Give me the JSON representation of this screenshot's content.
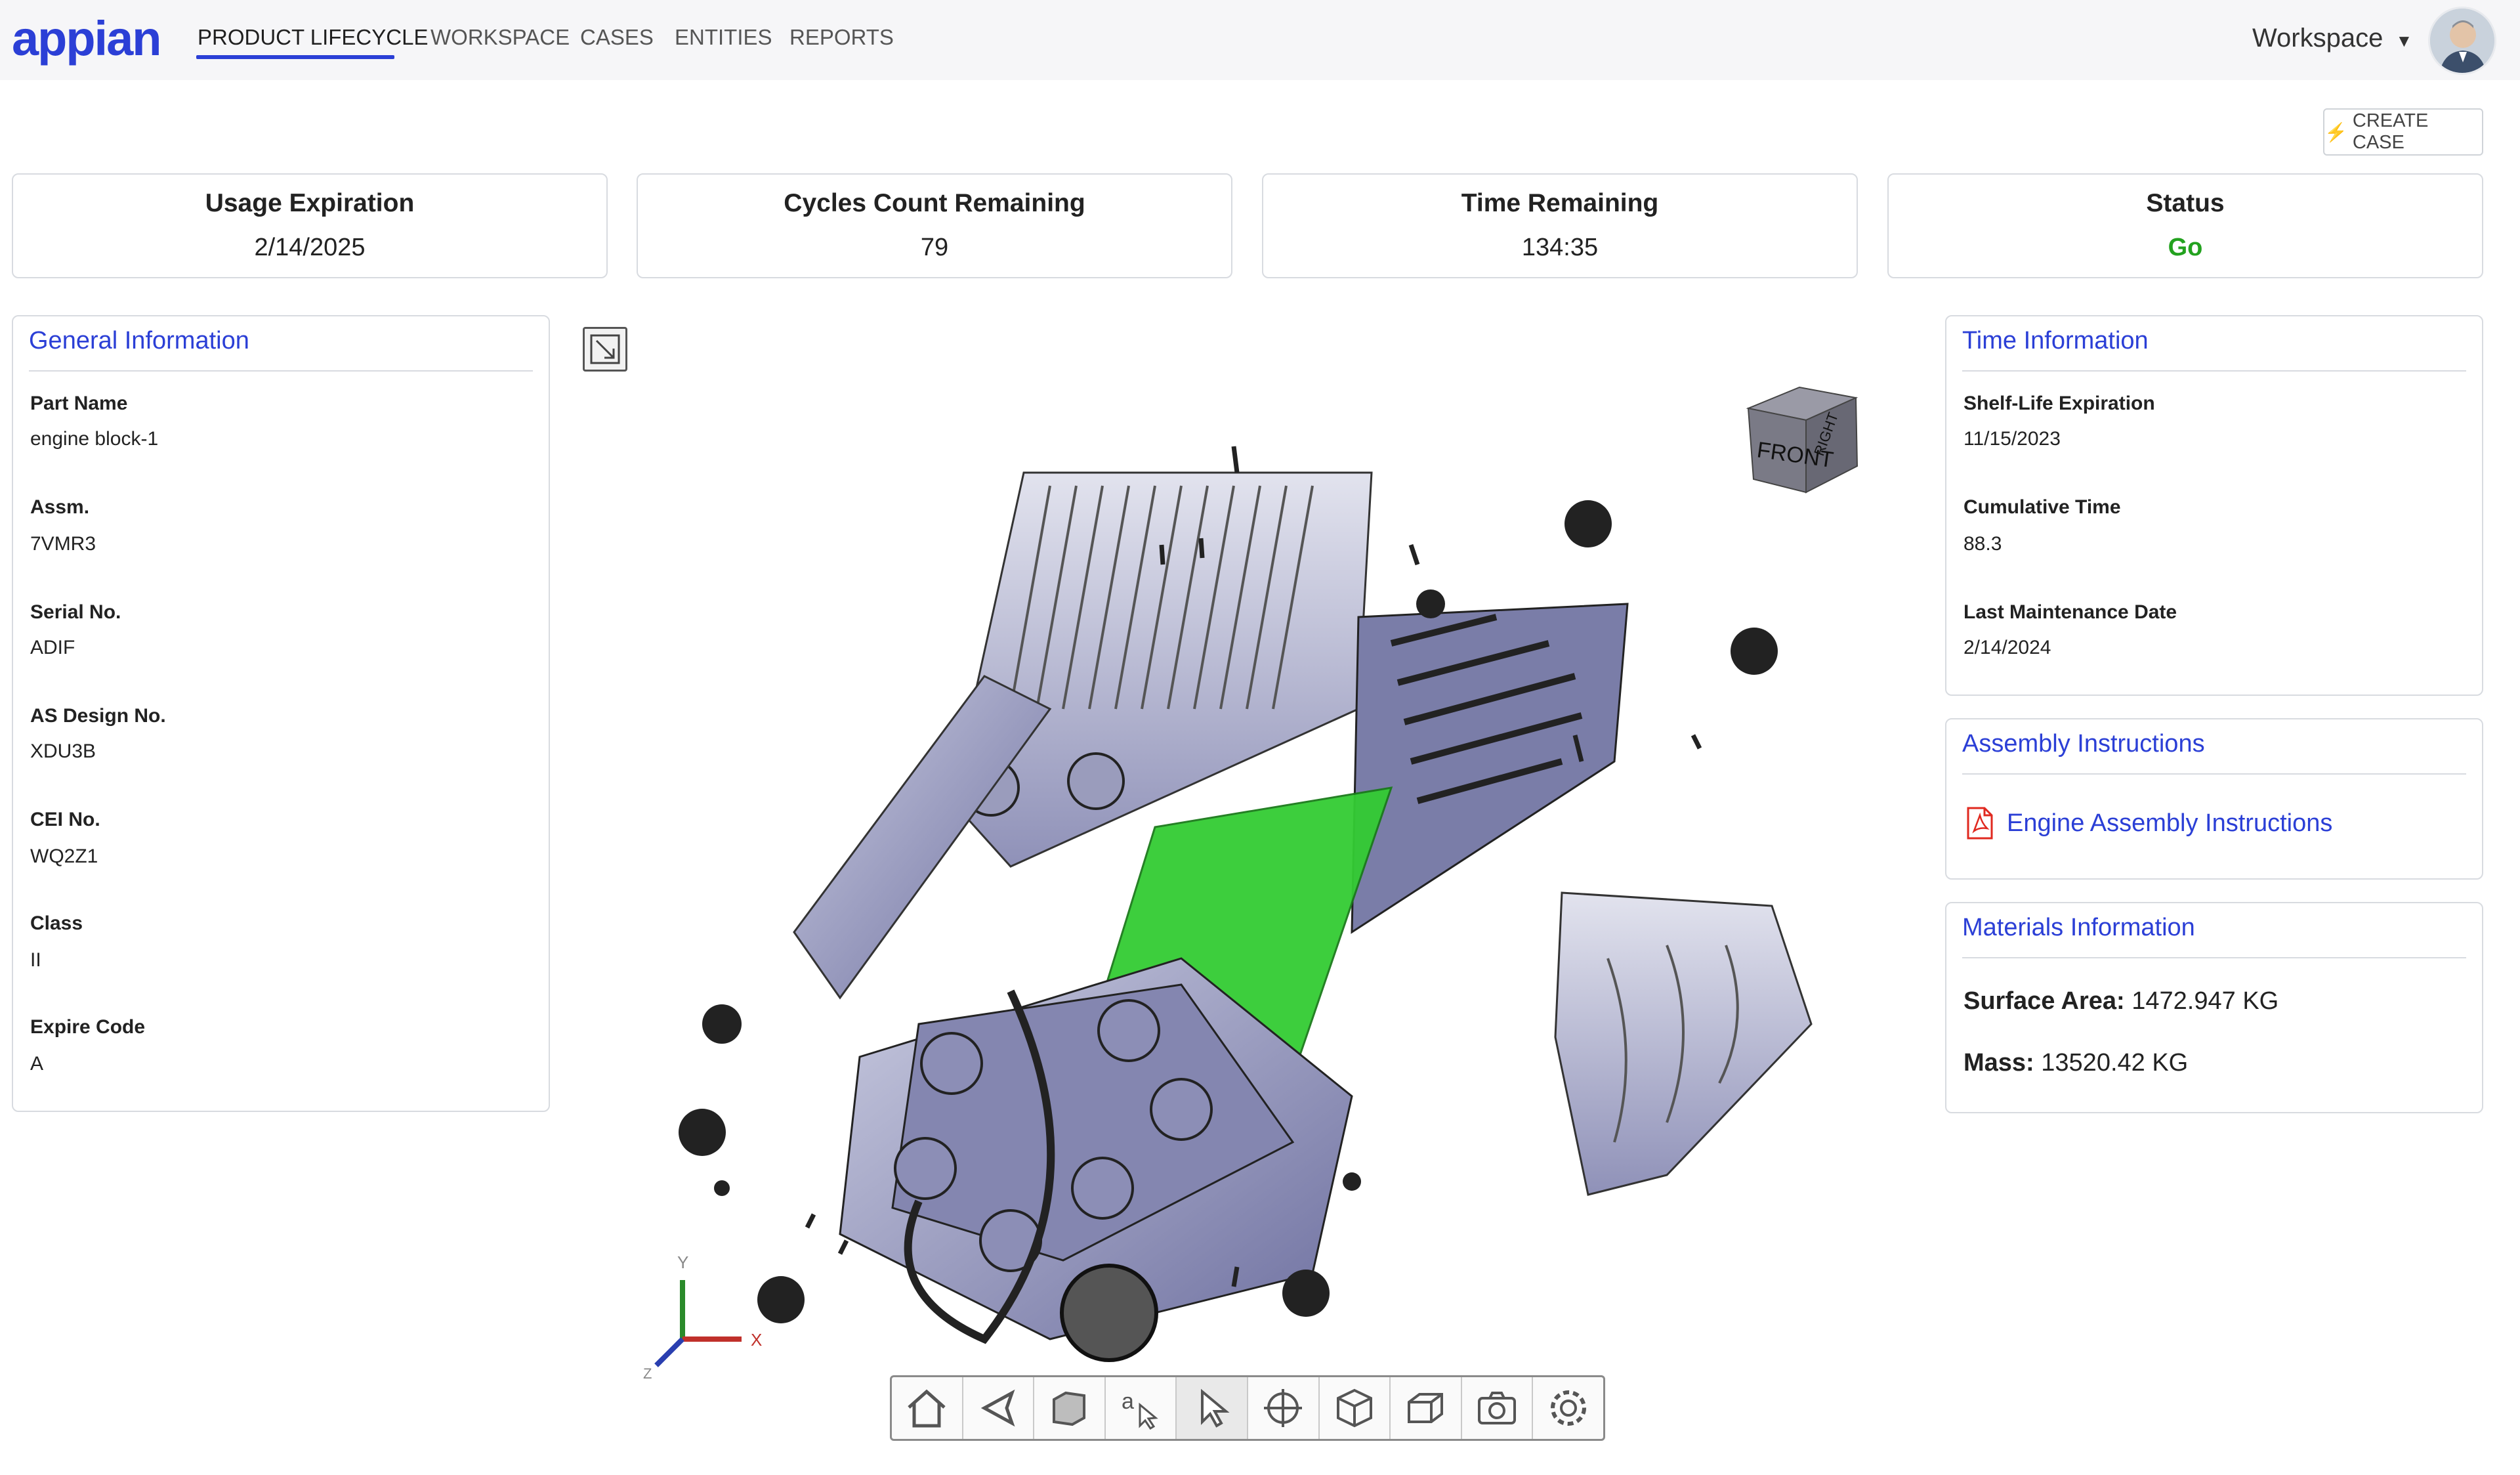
{
  "brand": {
    "logo": "appian",
    "accent": "#2b3fd6",
    "go_color": "#23a21f"
  },
  "nav": {
    "tabs": [
      {
        "label": "PRODUCT LIFECYCLE",
        "active": true
      },
      {
        "label": "WORKSPACE"
      },
      {
        "label": "CASES"
      },
      {
        "label": "ENTITIES"
      },
      {
        "label": "REPORTS"
      }
    ],
    "workspace_menu": "Workspace"
  },
  "actions": {
    "create_case": "CREATE CASE"
  },
  "kpis": [
    {
      "title": "Usage Expiration",
      "value": "2/14/2025"
    },
    {
      "title": "Cycles Count Remaining",
      "value": "79"
    },
    {
      "title": "Time Remaining",
      "value": "134:35"
    },
    {
      "title": "Status",
      "value": "Go"
    }
  ],
  "general": {
    "title": "General Information",
    "fields": [
      {
        "label": "Part Name",
        "value": "engine block-1"
      },
      {
        "label": "Assm.",
        "value": "7VMR3"
      },
      {
        "label": "Serial No.",
        "value": "ADIF"
      },
      {
        "label": "AS Design No.",
        "value": "XDU3B"
      },
      {
        "label": "CEI No.",
        "value": "WQ2Z1"
      },
      {
        "label": "Class",
        "value": "II"
      },
      {
        "label": "Expire Code",
        "value": "A"
      }
    ]
  },
  "time_info": {
    "title": "Time Information",
    "fields": [
      {
        "label": "Shelf-Life Expiration",
        "value": "11/15/2023"
      },
      {
        "label": "Cumulative Time",
        "value": "88.3"
      },
      {
        "label": "Last Maintenance Date",
        "value": "2/14/2024"
      }
    ]
  },
  "assembly": {
    "title": "Assembly Instructions",
    "link": "Engine Assembly Instructions"
  },
  "materials": {
    "title": "Materials Information",
    "surface_label": "Surface Area:",
    "surface_value": "1472.947 KG",
    "mass_label": "Mass:",
    "mass_value": "13520.42 KG"
  },
  "viewer": {
    "cube_front": "FRONT",
    "cube_right": "RIGHT",
    "axis_x": "X",
    "axis_y": "Y",
    "axis_z": "Z",
    "tools": [
      "home-icon",
      "back-icon",
      "box-icon",
      "annotate-icon",
      "select-icon",
      "orbit-icon",
      "explode-icon",
      "section-icon",
      "camera-icon",
      "settings-icon"
    ]
  }
}
